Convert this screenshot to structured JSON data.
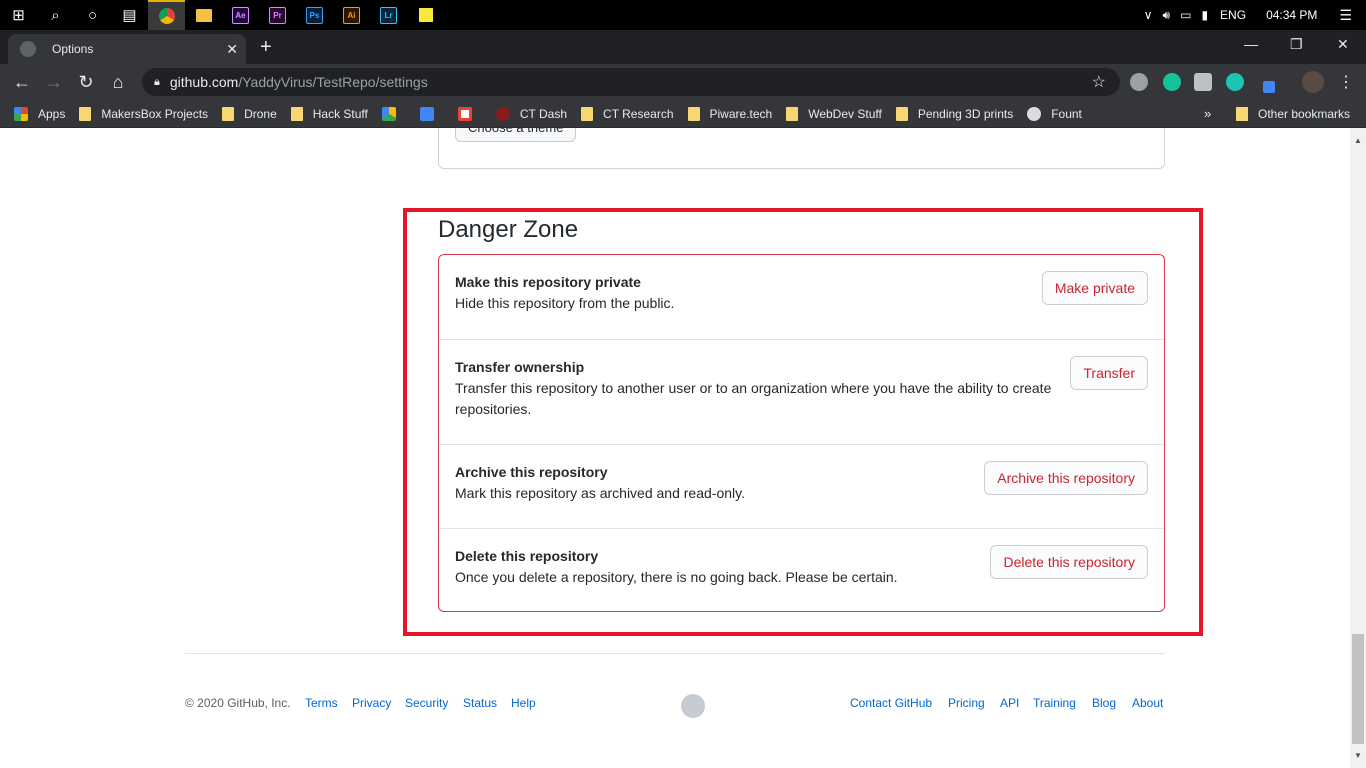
{
  "taskbar": {
    "apps": [
      "Ae",
      "Pr",
      "Ps",
      "Ai",
      "Lr"
    ],
    "language": "ENG",
    "time": "04:34 PM"
  },
  "browser": {
    "tab_title": "Options",
    "url_host": "github.com",
    "url_path": "/YaddyVirus/TestRepo/settings",
    "bookmarks": [
      "Apps",
      "MakersBox Projects",
      "Drone",
      "Hack Stuff",
      "CT Dash",
      "CT Research",
      "Piware.tech",
      "WebDev Stuff",
      "Pending 3D prints",
      "Fount"
    ],
    "more_bookmarks": "»",
    "other_bookmarks": "Other bookmarks"
  },
  "theme": {
    "button_label": "Choose a theme"
  },
  "danger_zone": {
    "title": "Danger Zone",
    "items": [
      {
        "heading": "Make this repository private",
        "description": "Hide this repository from the public.",
        "button": "Make private"
      },
      {
        "heading": "Transfer ownership",
        "description": "Transfer this repository to another user or to an organization where you have the ability to create repositories.",
        "button": "Transfer"
      },
      {
        "heading": "Archive this repository",
        "description": "Mark this repository as archived and read-only.",
        "button": "Archive this repository"
      },
      {
        "heading": "Delete this repository",
        "description": "Once you delete a repository, there is no going back. Please be certain.",
        "button": "Delete this repository"
      }
    ]
  },
  "footer": {
    "copyright": "© 2020 GitHub, Inc.",
    "left_links": [
      "Terms",
      "Privacy",
      "Security",
      "Status",
      "Help"
    ],
    "right_links": [
      "Contact GitHub",
      "Pricing",
      "API",
      "Training",
      "Blog",
      "About"
    ]
  },
  "colors": {
    "danger": "#d73a49",
    "danger_text": "#cb2431",
    "highlight": "#e3162a",
    "link": "#0366d6"
  }
}
